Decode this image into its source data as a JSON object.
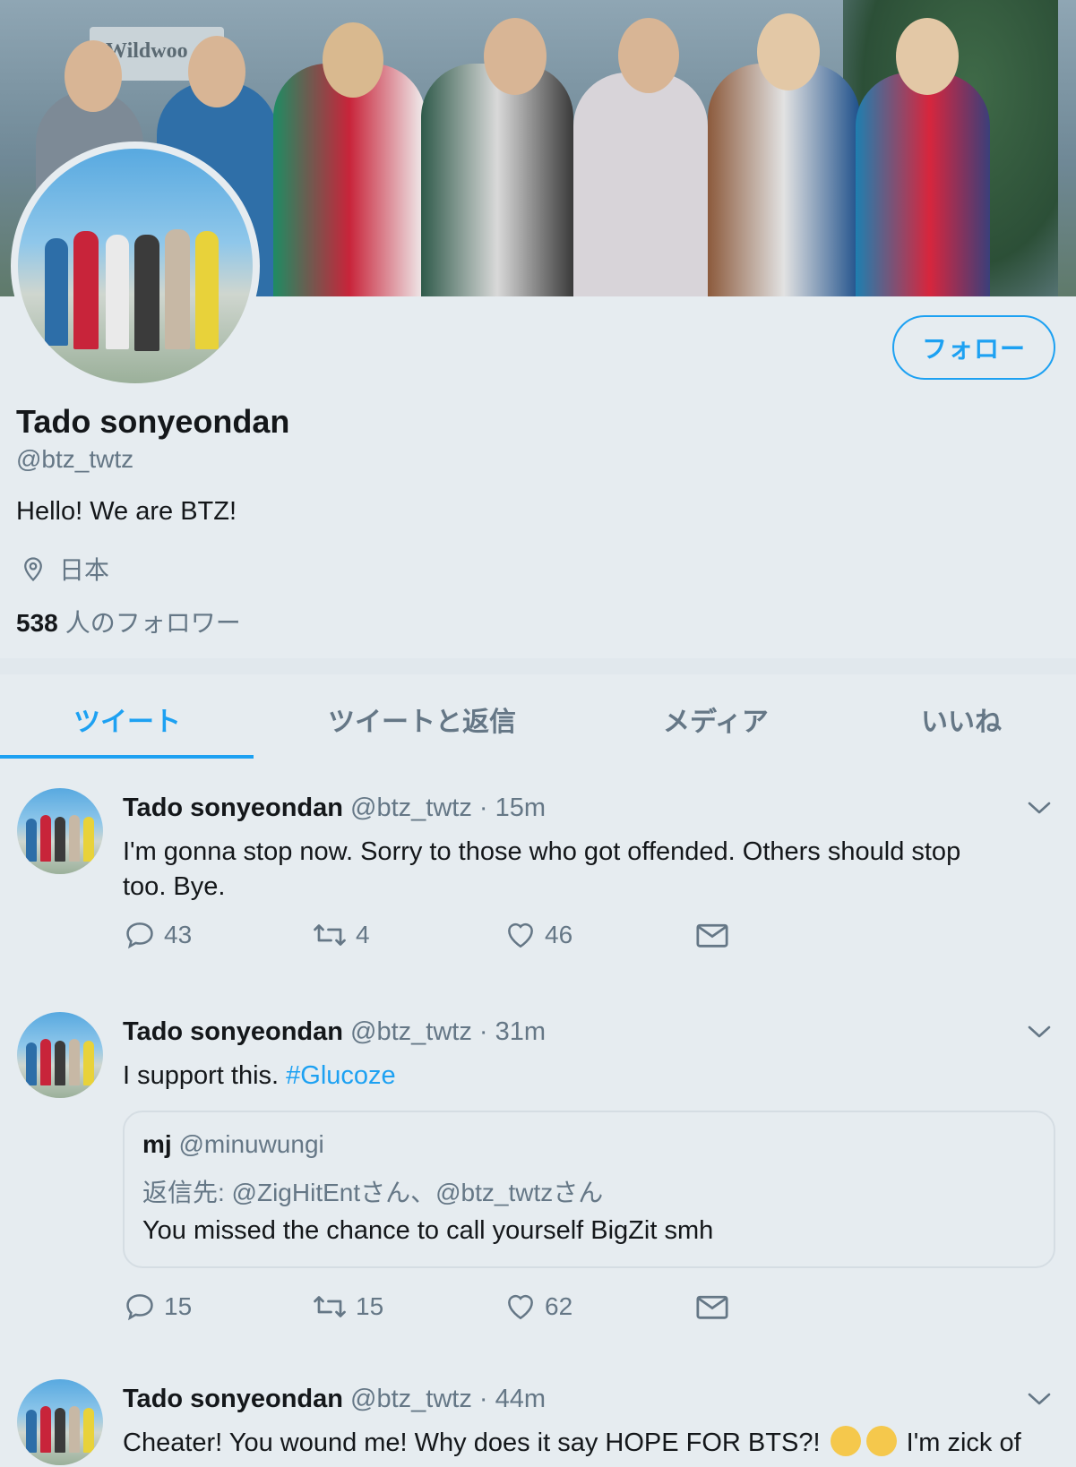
{
  "profile": {
    "banner_sign": "Wildwoo",
    "follow_label": "フォロー",
    "name": "Tado sonyeondan",
    "handle": "@btz_twtz",
    "bio": "Hello! We are BTZ!",
    "location": "日本",
    "followers_count": "538",
    "followers_label": "人のフォロワー"
  },
  "tabs": [
    {
      "label": "ツイート",
      "active": true
    },
    {
      "label": "ツイートと返信",
      "active": false
    },
    {
      "label": "メディア",
      "active": false
    },
    {
      "label": "いいね",
      "active": false
    }
  ],
  "tweets": [
    {
      "name": "Tado sonyeondan",
      "handle": "@btz_twtz",
      "time": "· 15m",
      "text_line1": "I'm gonna stop now. Sorry to those who got offended. Others should stop",
      "text_line2": "too. Bye.",
      "replies": "43",
      "retweets": "4",
      "likes": "46"
    },
    {
      "name": "Tado sonyeondan",
      "handle": "@btz_twtz",
      "time": "· 31m",
      "text": "I support this.",
      "hashtag": "#Glucoze",
      "quote": {
        "name": "mj",
        "handle": "@minuwungi",
        "reply_to": "返信先: @ZigHitEntさん、@btz_twtzさん",
        "text": "You missed the chance to call yourself BigZit smh"
      },
      "replies": "15",
      "retweets": "15",
      "likes": "62"
    },
    {
      "name": "Tado sonyeondan",
      "handle": "@btz_twtz",
      "time": "· 44m",
      "text_start": "Cheater! You wound me! Why does it say HOPE FOR BTS?!",
      "text_end": "I'm zick of"
    }
  ],
  "colors": {
    "accent": "#1da1f2",
    "background": "#e6ecf0",
    "secondary_text": "#657786"
  }
}
